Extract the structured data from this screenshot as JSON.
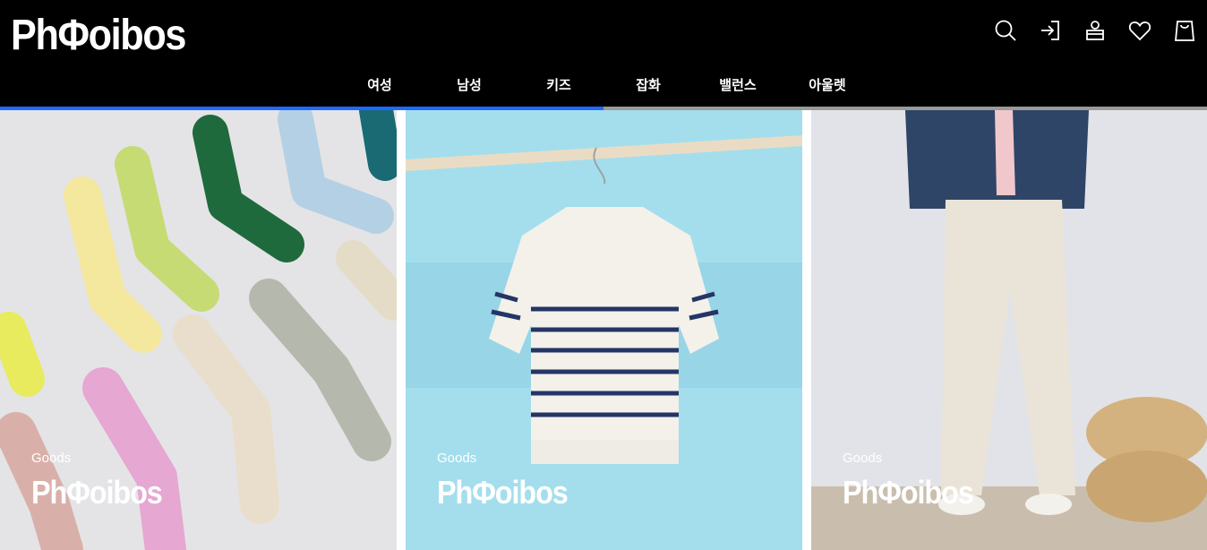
{
  "brand": {
    "logo_text": "PhΦoibos"
  },
  "header_icons": [
    "search-icon",
    "login-icon",
    "account-icon",
    "wishlist-icon",
    "cart-icon"
  ],
  "nav": {
    "items": [
      {
        "label": "여성"
      },
      {
        "label": "남성"
      },
      {
        "label": "키즈"
      },
      {
        "label": "잡화"
      },
      {
        "label": "밸런스"
      },
      {
        "label": "아울렛"
      }
    ]
  },
  "slider": {
    "progress": 0.5,
    "colors": {
      "progress_fill": "#1f6bff",
      "progress_track": "#9a9a9a"
    },
    "slides": [
      {
        "subtitle": "Goods",
        "title": "PhΦoibos",
        "image": "colorful ribbed socks"
      },
      {
        "subtitle": "Goods",
        "title": "PhΦoibos",
        "image": "striped knit polo on branch"
      },
      {
        "subtitle": "Goods",
        "title": "PhΦoibos",
        "image": "man in beige chinos and navy jacket"
      }
    ]
  }
}
